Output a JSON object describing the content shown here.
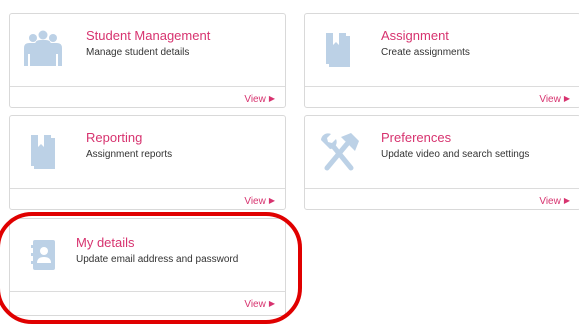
{
  "cards": [
    {
      "title": "Student Management",
      "description": "Manage student details",
      "link": "View",
      "icon": "users-icon"
    },
    {
      "title": "Assignment",
      "description": "Create assignments",
      "link": "View",
      "icon": "book-icon"
    },
    {
      "title": "Reporting",
      "description": "Assignment reports",
      "link": "View",
      "icon": "book-icon"
    },
    {
      "title": "Preferences",
      "description": "Update video and search settings",
      "link": "View",
      "icon": "tools-icon"
    },
    {
      "title": "My details",
      "description": "Update email address and password",
      "link": "View",
      "icon": "contact-card-icon"
    }
  ],
  "colors": {
    "accent": "#d7336f",
    "icon": "#bcd1e6",
    "highlight": "#e00000"
  }
}
